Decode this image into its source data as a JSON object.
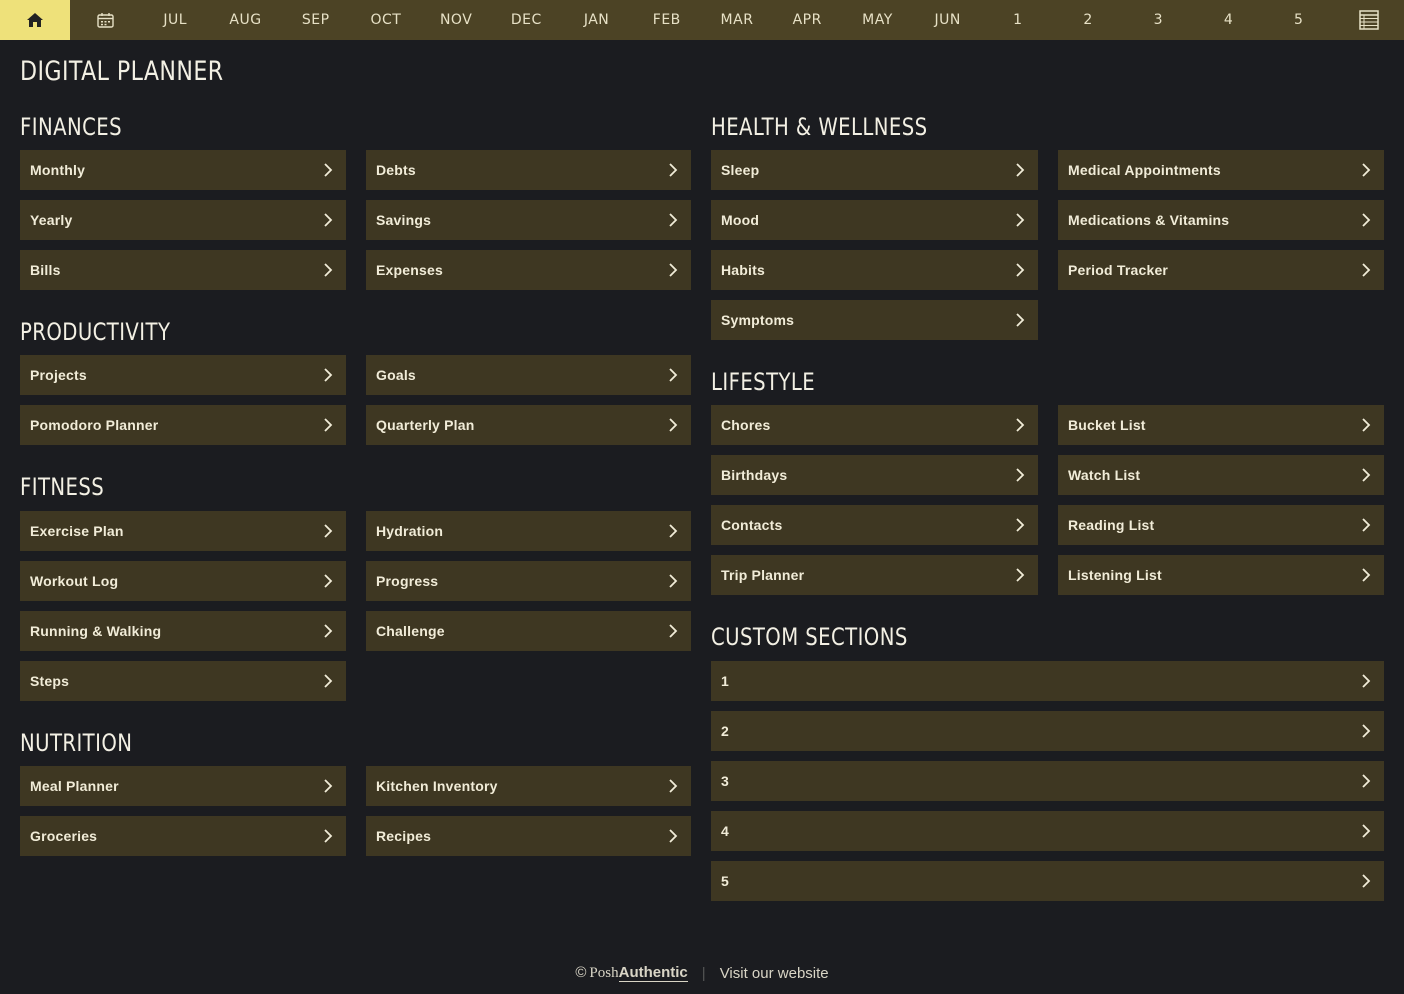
{
  "nav": {
    "home_icon": "home-icon",
    "calendar_icon": "calendar-icon",
    "months": [
      "JUL",
      "AUG",
      "SEP",
      "OCT",
      "NOV",
      "DEC",
      "JAN",
      "FEB",
      "MAR",
      "APR",
      "MAY",
      "JUN"
    ],
    "numbers": [
      "1",
      "2",
      "3",
      "4",
      "5"
    ],
    "notes_icon": "notes-grid-icon",
    "colors": {
      "bar": "#4c4325",
      "home": "#eee17a"
    }
  },
  "title": "DIGITAL PLANNER",
  "sections": {
    "finances": {
      "title": "FINANCES",
      "items": [
        "Monthly",
        "Debts",
        "Yearly",
        "Savings",
        "Bills",
        "Expenses"
      ]
    },
    "productivity": {
      "title": "PRODUCTIVITY",
      "items": [
        "Projects",
        "Goals",
        "Pomodoro Planner",
        "Quarterly Plan"
      ]
    },
    "fitness": {
      "title": "FITNESS",
      "items": [
        "Exercise Plan",
        "Hydration",
        "Workout Log",
        "Progress",
        "Running & Walking",
        "Challenge",
        "Steps"
      ]
    },
    "nutrition": {
      "title": "NUTRITION",
      "items": [
        "Meal Planner",
        "Kitchen Inventory",
        "Groceries",
        "Recipes"
      ]
    },
    "health": {
      "title": "HEALTH & WELLNESS",
      "items": [
        "Sleep",
        "Medical Appointments",
        "Mood",
        "Medications & Vitamins",
        "Habits",
        "Period Tracker",
        "Symptoms"
      ]
    },
    "lifestyle": {
      "title": "LIFESTYLE",
      "items": [
        "Chores",
        "Bucket List",
        "Birthdays",
        "Watch List",
        "Contacts",
        "Reading List",
        "Trip Planner",
        "Listening List"
      ]
    },
    "custom": {
      "title": "CUSTOM SECTIONS",
      "items": [
        "1",
        "2",
        "3",
        "4",
        "5"
      ]
    }
  },
  "footer": {
    "copyright": "©",
    "brand_posh": "Posh",
    "brand_authentic": "Authentic",
    "separator": "|",
    "link": "Visit our website"
  },
  "colors": {
    "background": "#1b1c20",
    "button": "#3e3722",
    "text": "#f1ecd8"
  }
}
